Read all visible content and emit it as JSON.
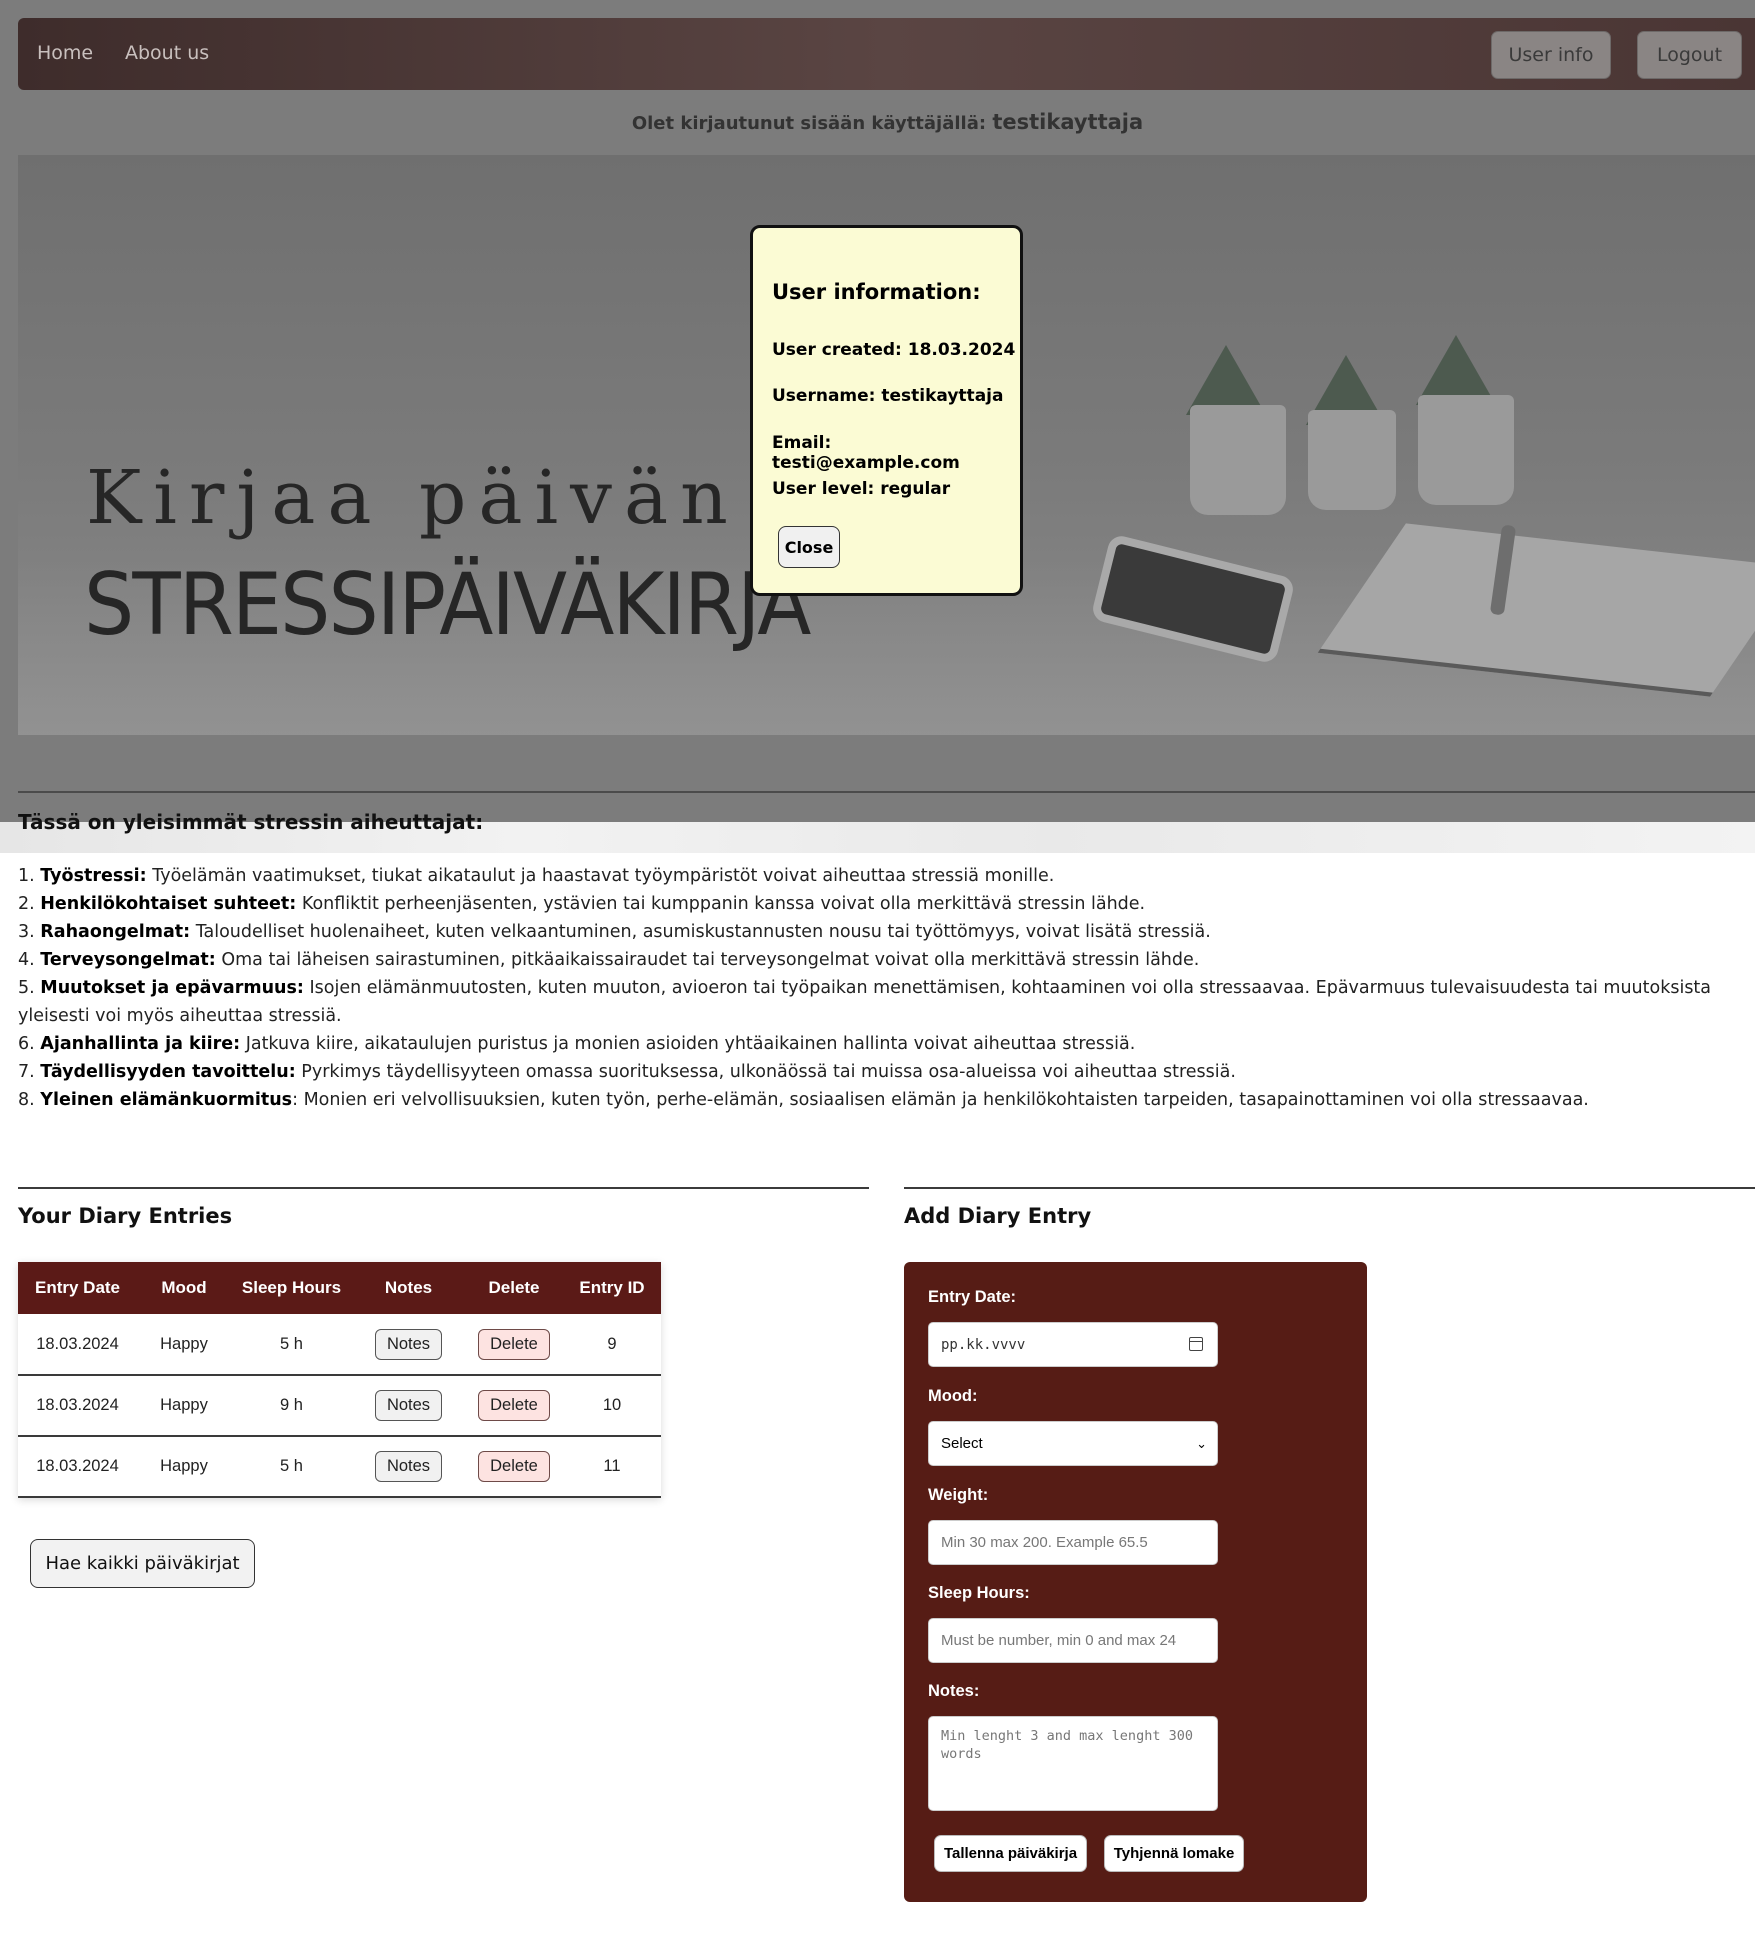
{
  "nav": {
    "home": "Home",
    "about": "About us",
    "user_info": "User info",
    "logout": "Logout"
  },
  "login_status": {
    "prefix": "Olet kirjautunut sisään käyttäjällä:",
    "username": "testikayttaja"
  },
  "hero": {
    "subtitle": "Kirjaa päivän fii",
    "title": "STRESSIPÄIVÄKIRJA"
  },
  "causes": {
    "title": "Tässä on yleisimmät stressin aiheuttajat:",
    "items": [
      {
        "num": "1.",
        "term": "Työstressi:",
        "text": " Työelämän vaatimukset, tiukat aikataulut ja haastavat työympäristöt voivat aiheuttaa stressiä monille."
      },
      {
        "num": "2.",
        "term": "Henkilökohtaiset suhteet:",
        "text": " Konfliktit perheenjäsenten, ystävien tai kumppanin kanssa voivat olla merkittävä stressin lähde."
      },
      {
        "num": "3.",
        "term": "Rahaongelmat:",
        "text": " Taloudelliset huolenaiheet, kuten velkaantuminen, asumiskustannusten nousu tai työttömyys, voivat lisätä stressiä."
      },
      {
        "num": "4.",
        "term": "Terveysongelmat:",
        "text": " Oma tai läheisen sairastuminen, pitkäaikaissairaudet tai terveysongelmat voivat olla merkittävä stressin lähde."
      },
      {
        "num": "5.",
        "term": "Muutokset ja epävarmuus:",
        "text": " Isojen elämänmuutosten, kuten muuton, avioeron tai työpaikan menettämisen, kohtaaminen voi olla stressaavaa. Epävarmuus tulevaisuudesta tai muutoksista yleisesti voi myös aiheuttaa stressiä."
      },
      {
        "num": "6.",
        "term": "Ajanhallinta ja kiire:",
        "text": " Jatkuva kiire, aikataulujen puristus ja monien asioiden yhtäaikainen hallinta voivat aiheuttaa stressiä."
      },
      {
        "num": "7.",
        "term": "Täydellisyyden tavoittelu:",
        "text": " Pyrkimys täydellisyyteen omassa suorituksessa, ulkonäössä tai muissa osa-alueissa voi aiheuttaa stressiä."
      },
      {
        "num": "8.",
        "term": "Yleinen elämänkuormitus",
        "text": ": Monien eri velvollisuuksien, kuten työn, perhe-elämän, sosiaalisen elämän ja henkilökohtaisten tarpeiden, tasapainottaminen voi olla stressaavaa."
      }
    ]
  },
  "entries": {
    "title": "Your Diary Entries",
    "headers": [
      "Entry Date",
      "Mood",
      "Sleep Hours",
      "Notes",
      "Delete",
      "Entry ID"
    ],
    "rows": [
      {
        "date": "18.03.2024",
        "mood": "Happy",
        "sleep": "5 h",
        "notes": "Notes",
        "delete": "Delete",
        "id": "9"
      },
      {
        "date": "18.03.2024",
        "mood": "Happy",
        "sleep": "9 h",
        "notes": "Notes",
        "delete": "Delete",
        "id": "10"
      },
      {
        "date": "18.03.2024",
        "mood": "Happy",
        "sleep": "5 h",
        "notes": "Notes",
        "delete": "Delete",
        "id": "11"
      }
    ],
    "fetch_button": "Hae kaikki päiväkirjat"
  },
  "form": {
    "title": "Add Diary Entry",
    "date_label": "Entry Date:",
    "date_placeholder": "pp.kk.vvvv",
    "mood_label": "Mood:",
    "mood_selected": "Select",
    "weight_label": "Weight:",
    "weight_placeholder": "Min 30 max 200. Example 65.5",
    "sleep_label": "Sleep Hours:",
    "sleep_placeholder": "Must be number, min 0 and max 24",
    "notes_label": "Notes:",
    "notes_placeholder": "Min lenght 3 and max lenght 300 words",
    "save_button": "Tallenna päiväkirja",
    "clear_button": "Tyhjennä lomake",
    "background_color": "#561c15"
  },
  "modal": {
    "heading": "User information:",
    "created": "User created: 18.03.2024",
    "username": "Username: testikayttaja",
    "email": "Email: testi@example.com",
    "level": "User level: regular",
    "close": "Close",
    "background_color": "#fbfbd4"
  },
  "colors": {
    "accent": "#5b1a17",
    "navbar": "#4a3534"
  }
}
